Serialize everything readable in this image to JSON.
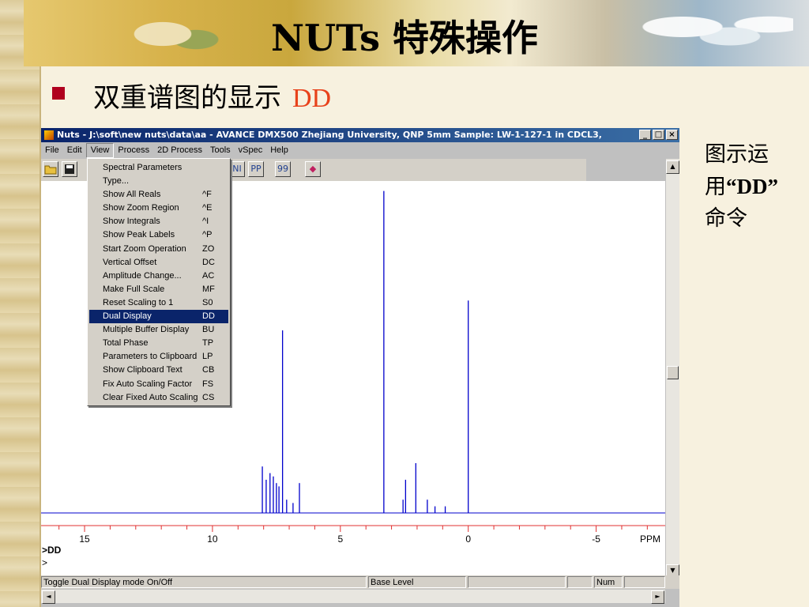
{
  "slide": {
    "title": "NUTs 特殊操作",
    "subtitle": "双重谱图的显示",
    "subtitle_cmd": "DD",
    "note_line1": "图示运",
    "note_line2_pre": "用",
    "note_line2_bold": "“DD”",
    "note_line3": "命令",
    "accent_red": "#e8421b",
    "bullet_color": "#b0001e"
  },
  "window": {
    "title": "Nuts - J:\\soft\\new nuts\\data\\aa - AVANCE DMX500 Zhejiang University, QNP 5mm Sample: LW-1-127-1 in CDCL3,",
    "minimize": "_",
    "maximize": "□",
    "close": "×",
    "menus": [
      "File",
      "Edit",
      "View",
      "Process",
      "2D Process",
      "Tools",
      "vSpec",
      "Help"
    ],
    "open_menu": "View"
  },
  "view_menu": {
    "items": [
      {
        "label": "Spectral Parameters",
        "shortcut": ""
      },
      {
        "label": "Type...",
        "shortcut": ""
      },
      {
        "label": "Show All Reals",
        "shortcut": "^F"
      },
      {
        "label": "Show Zoom Region",
        "shortcut": "^E"
      },
      {
        "label": "Show Integrals",
        "shortcut": "^I"
      },
      {
        "label": "Show Peak Labels",
        "shortcut": "^P"
      },
      {
        "label": "Start Zoom Operation",
        "shortcut": "ZO"
      },
      {
        "label": "Vertical Offset",
        "shortcut": "DC"
      },
      {
        "label": "Amplitude Change...",
        "shortcut": "AC"
      },
      {
        "label": "Make Full Scale",
        "shortcut": "MF"
      },
      {
        "label": "Reset Scaling to 1",
        "shortcut": "S0"
      },
      {
        "label": "Dual Display",
        "shortcut": "DD"
      },
      {
        "label": "Multiple Buffer Display",
        "shortcut": "BU"
      },
      {
        "label": "Total Phase",
        "shortcut": "TP"
      },
      {
        "label": "Parameters to Clipboard",
        "shortcut": "LP"
      },
      {
        "label": "Show Clipboard Text",
        "shortcut": "CB"
      },
      {
        "label": "Fix Auto Scaling Factor",
        "shortcut": "FS"
      },
      {
        "label": "Clear Fixed Auto Scaling",
        "shortcut": "CS"
      }
    ],
    "highlighted": "Dual Display"
  },
  "toolbar": {
    "icons": [
      "open-folder-icon",
      "save-disk-icon",
      "spectrum-ni-icon",
      "spectrum-pp-icon",
      "glasses-icon",
      "book-icon"
    ],
    "btn_ni": "NI",
    "btn_pp": "PP",
    "btn_glasses": "99",
    "btn_book": "◆"
  },
  "axis": {
    "tick_labels": [
      "15",
      "10",
      "5",
      "0",
      "-5"
    ],
    "unit": "PPM",
    "spectrum_color": "#0000cc",
    "axis_color": "#e03030"
  },
  "chart_data": {
    "type": "line",
    "title": "",
    "xlabel": "PPM",
    "ylabel": "",
    "x_reversed": true,
    "xlim": [
      16.7,
      -7.7
    ],
    "ylim": [
      0,
      1
    ],
    "peaks_ppm": [
      8.05,
      7.9,
      7.75,
      7.62,
      7.5,
      7.4,
      7.26,
      7.1,
      6.85,
      6.6,
      3.3,
      2.55,
      2.45,
      2.05,
      1.6,
      1.3,
      0.9,
      0.0
    ],
    "peak_heights": [
      0.14,
      0.1,
      0.12,
      0.11,
      0.09,
      0.08,
      0.55,
      0.04,
      0.03,
      0.09,
      0.97,
      0.04,
      0.1,
      0.15,
      0.04,
      0.02,
      0.02,
      0.64
    ]
  },
  "command": {
    "line1": ">DD",
    "line2": ">"
  },
  "statusbar": {
    "message": "Toggle Dual Display mode On/Off",
    "base_level": "Base Level",
    "num": "Num"
  }
}
